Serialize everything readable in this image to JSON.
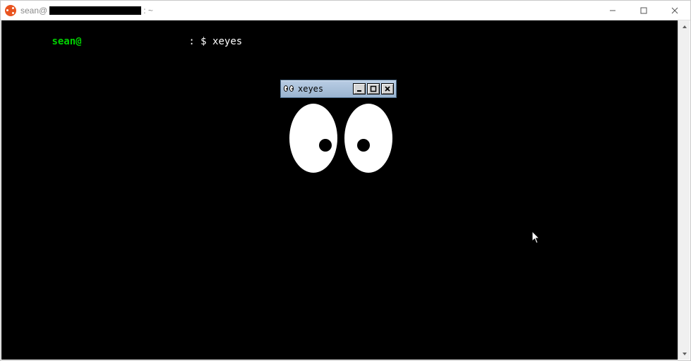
{
  "outer_window": {
    "title_prefix": "sean@",
    "title_suffix": ": ~",
    "controls": {
      "min": "minimize",
      "max": "maximize",
      "close": "close"
    }
  },
  "terminal": {
    "prompt_user": "sean@",
    "prompt_sep": ": ",
    "prompt_symbol": "$ ",
    "command": "xeyes"
  },
  "xeyes_window": {
    "title": "xeyes",
    "controls": {
      "min": "_",
      "max": "□",
      "close": "×"
    }
  }
}
